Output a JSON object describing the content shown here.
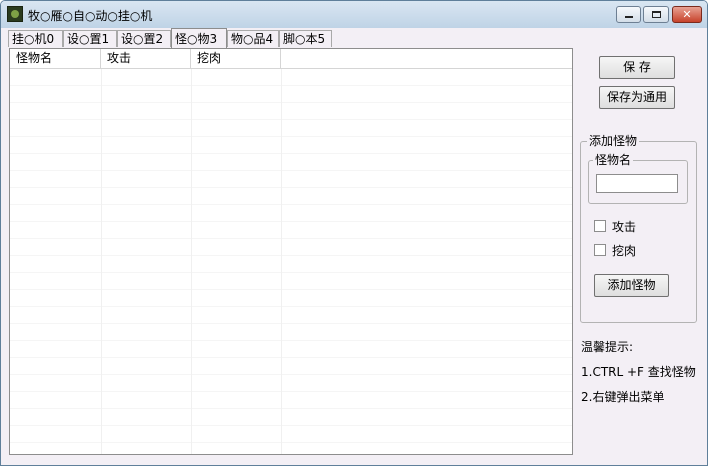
{
  "window": {
    "title": "牧○雁○自○动○挂○机",
    "icon": "app-icon",
    "controls": {
      "minimize": "–",
      "maximize": "□",
      "close": "✕"
    }
  },
  "tabs": [
    {
      "label": "挂○机0",
      "active": false
    },
    {
      "label": "设○置1",
      "active": false
    },
    {
      "label": "设○置2",
      "active": false
    },
    {
      "label": "怪○物3",
      "active": true
    },
    {
      "label": "物○品4",
      "active": false
    },
    {
      "label": "脚○本5",
      "active": false
    }
  ],
  "list": {
    "columns": [
      "怪物名",
      "攻击",
      "挖肉",
      ""
    ],
    "rows": []
  },
  "buttons": {
    "save": "保 存",
    "save_general": "保存为通用",
    "add_monster": "添加怪物"
  },
  "add_group": {
    "title": "添加怪物",
    "name_group_title": "怪物名",
    "name_value": "",
    "attack_label": "攻击",
    "attack_checked": false,
    "meat_label": "挖肉",
    "meat_checked": false
  },
  "tips": {
    "title": "温馨提示:",
    "line1": "1.CTRL +F 查找怪物",
    "line2": "2.右键弹出菜单"
  }
}
